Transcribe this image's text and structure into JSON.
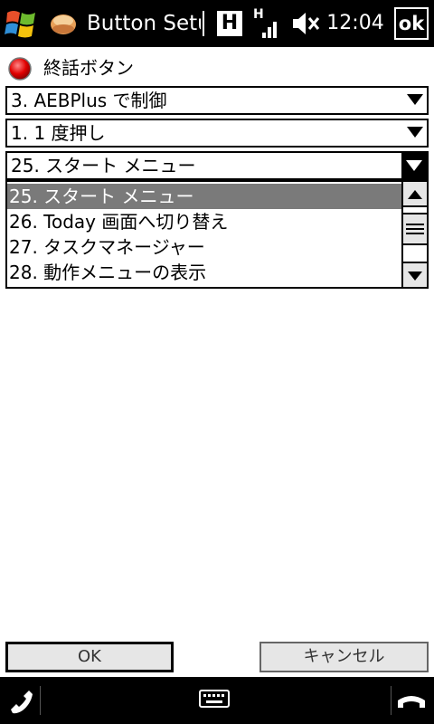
{
  "titlebar": {
    "title": "Button Setup",
    "badge": "H",
    "network": "H",
    "time": "12:04",
    "ok_label": "ok"
  },
  "header": {
    "label": "終話ボタン",
    "indicator_color": "#e00000"
  },
  "dropdowns": {
    "action_type": "3. AEBPlus で制御",
    "press_type": "1. 1 度押し",
    "command": "25. スタート メニュー"
  },
  "command_list": {
    "items": [
      {
        "label": "25. スタート メニュー",
        "selected": true
      },
      {
        "label": "26. Today 画面へ切り替え",
        "selected": false
      },
      {
        "label": "27. タスクマネージャー",
        "selected": false
      },
      {
        "label": "28. 動作メニューの表示",
        "selected": false
      }
    ]
  },
  "buttons": {
    "ok_label": "OK",
    "cancel_label": "キャンセル"
  },
  "icons": {
    "start": "windows-start-icon",
    "app": "app-icon",
    "signal": "signal-icon",
    "speaker": "speaker-muted-icon",
    "call": "call-icon",
    "keyboard": "keyboard-icon",
    "hangup": "hangup-icon"
  }
}
